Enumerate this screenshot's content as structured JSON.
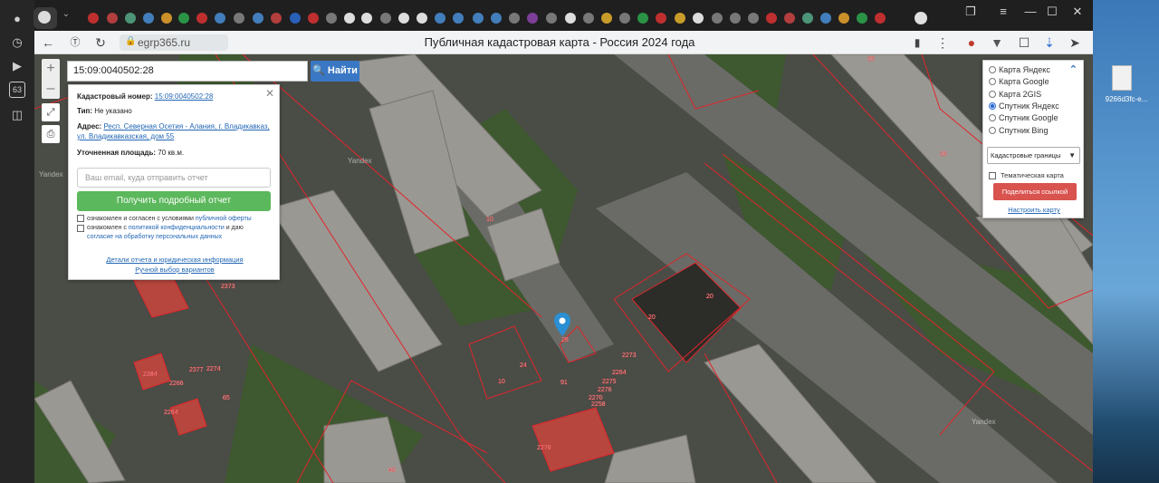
{
  "browser": {
    "url": "egrp365.ru",
    "page_title": "Публичная кадастровая карта - Россия 2024 года",
    "sidebar_badge": "63"
  },
  "map": {
    "search": {
      "value": "15:09:0040502:28",
      "button_label": "Найти"
    },
    "info_card": {
      "cadastral_label": "Кадастровый номер:",
      "cadastral_value": "15:09:0040502:28",
      "type_label": "Тип:",
      "type_value": "Не указано",
      "address_label": "Адрес:",
      "address_value_line1": "Респ. Северная Осетия - Алания, г. Владикавказ,",
      "address_value_line2": "ул. Владикавказская, дом 55",
      "area_label": "Уточненная площадь:",
      "area_value": "70 кв.м.",
      "email_placeholder": "Ваш email, куда отправить отчет",
      "report_button": "Получить подробный отчет",
      "consent1_text": "ознакомлен и согласен с условиями",
      "consent1_link": "публичной оферты",
      "consent2_text": "ознакомлен с",
      "consent2_link": "политикой конфиденциальности",
      "consent2_tail": "и даю",
      "consent3_link": "согласие на обработку персональных данных",
      "details_link": "Детали отчета и юридическая информация",
      "manual_link": "Ручной выбор вариантов"
    },
    "layers": {
      "options": [
        "Карта Яндекс",
        "Карта Google",
        "Карта 2GIS",
        "Спутник Яндекс",
        "Спутник Google",
        "Спутник Bing"
      ],
      "selected_index": 3,
      "overlay_select": "Кадастровые границы",
      "thematic_label": "Тематическая карта",
      "share_button": "Поделиться ссылкой",
      "configure_link": "Настроить карту"
    },
    "watermark": "Yandex",
    "labels": [
      "26",
      "26",
      "10",
      "20",
      "20",
      "24",
      "28",
      "10",
      "90",
      "65",
      "91",
      "2273",
      "2264",
      "2275",
      "2276",
      "2270",
      "2258",
      "2270",
      "2264",
      "2266",
      "2377",
      "2274",
      "2373",
      "2384"
    ]
  },
  "desktop": {
    "file_label": "9266d3fc-e..."
  },
  "colors": {
    "accent_blue": "#3a78c5",
    "report_green": "#5cb85c",
    "share_red": "#d9534f",
    "parcel_border": "#e0262b"
  }
}
